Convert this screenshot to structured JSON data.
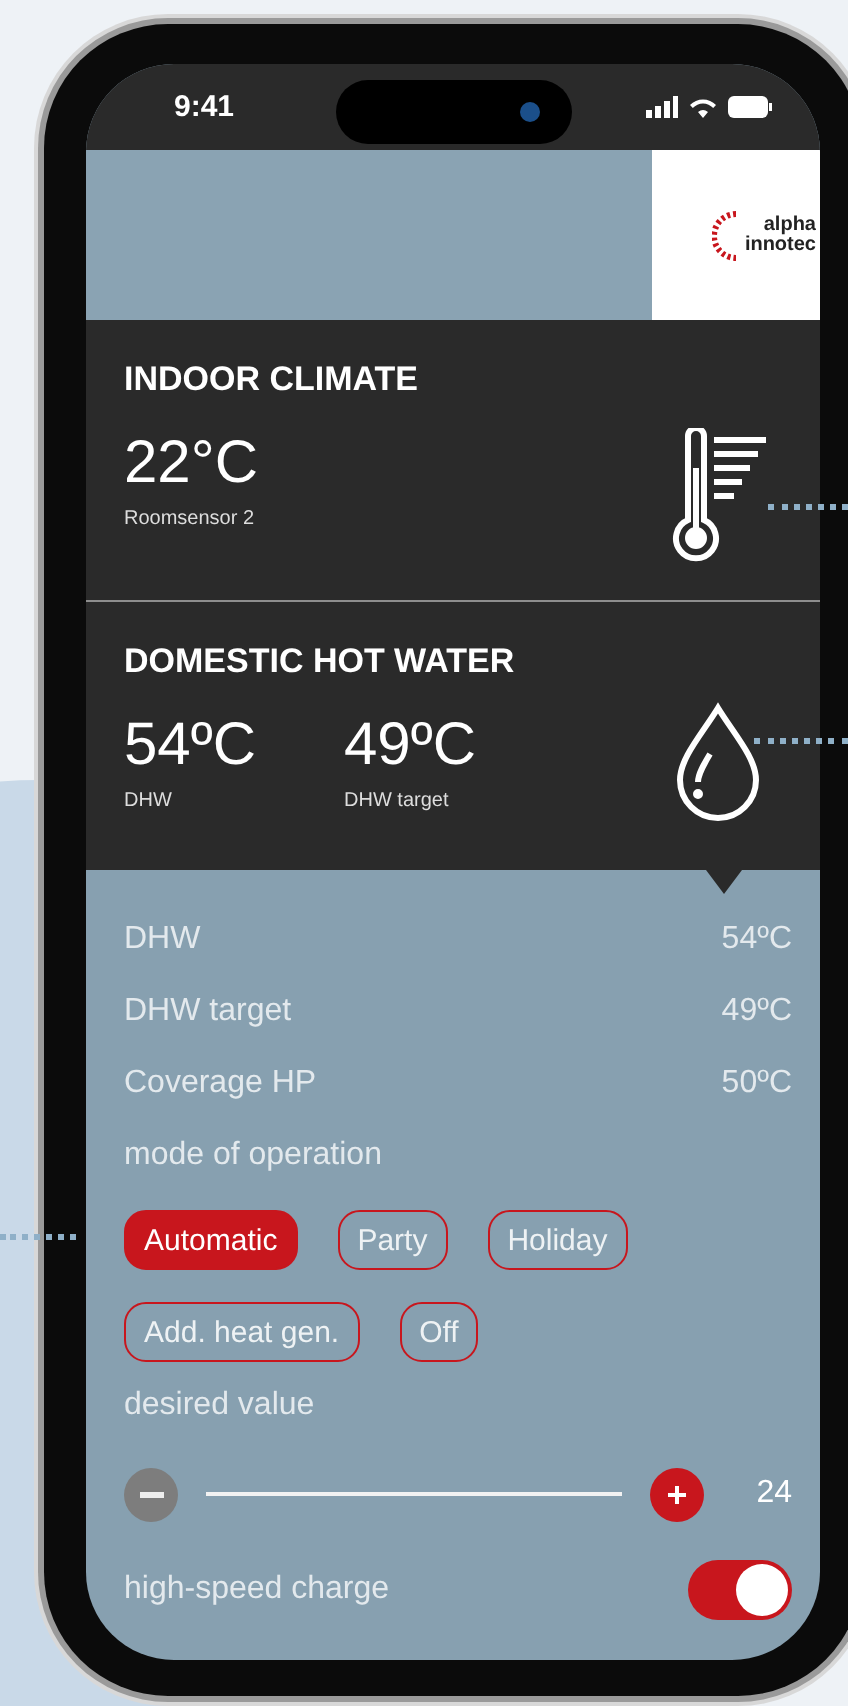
{
  "status_bar": {
    "time": "9:41"
  },
  "logo": {
    "line_1": "alpha",
    "line_2": "innotec"
  },
  "indoor_climate": {
    "title": "INDOOR CLIMATE",
    "reading": "22°C",
    "sensor": "Roomsensor 2"
  },
  "hot_water": {
    "title": "DOMESTIC HOT WATER",
    "readings": [
      {
        "value": "54ºC",
        "label": "DHW"
      },
      {
        "value": "49ºC",
        "label": "DHW target"
      }
    ]
  },
  "details": [
    {
      "label": "DHW",
      "value": "54ºC"
    },
    {
      "label": "DHW target",
      "value": "49ºC"
    },
    {
      "label": "Coverage HP",
      "value": "50ºC"
    }
  ],
  "mode": {
    "label": "mode of operation",
    "options": [
      {
        "label": "Automatic",
        "selected": true
      },
      {
        "label": "Party",
        "selected": false
      },
      {
        "label": "Holiday",
        "selected": false
      },
      {
        "label": "Add. heat gen.",
        "selected": false
      },
      {
        "label": "Off",
        "selected": false
      }
    ]
  },
  "desired": {
    "label": "desired value",
    "value": "24"
  },
  "fast_charge": {
    "label": "high-speed charge",
    "on": true
  }
}
